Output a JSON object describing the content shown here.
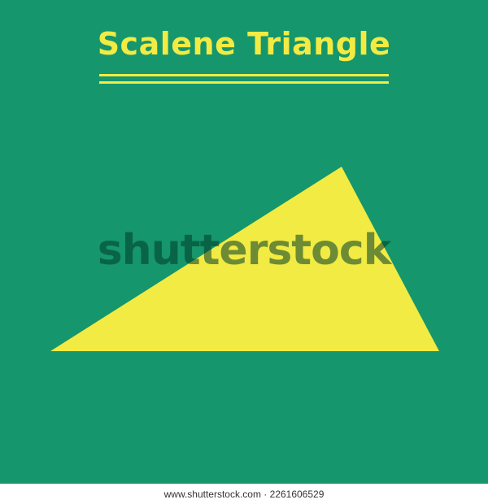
{
  "title": "Scalene Triangle",
  "watermark": "shutterstock",
  "footer": "www.shutterstock.com · 2261606529",
  "colors": {
    "background": "#16966c",
    "accent": "#f2eb43"
  },
  "shape": {
    "type": "scalene-triangle"
  }
}
